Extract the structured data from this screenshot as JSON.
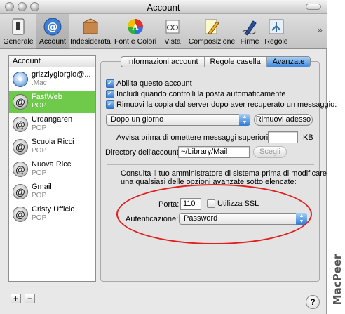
{
  "window": {
    "title": "Account"
  },
  "toolbar": {
    "items": [
      {
        "label": "Generale",
        "icon": "switch-icon"
      },
      {
        "label": "Account",
        "icon": "at-icon"
      },
      {
        "label": "Indesiderata",
        "icon": "junk-icon"
      },
      {
        "label": "Font e Colori",
        "icon": "color-wheel-icon"
      },
      {
        "label": "Vista",
        "icon": "glasses-icon"
      },
      {
        "label": "Composizione",
        "icon": "pencil-icon"
      },
      {
        "label": "Firme",
        "icon": "fountain-pen-icon"
      },
      {
        "label": "Regole",
        "icon": "rules-icon"
      }
    ],
    "more": "»"
  },
  "accounts": {
    "header": "Account",
    "items": [
      {
        "name": "grizzlygiorgio@...",
        "type": ".Mac"
      },
      {
        "name": "FastWeb",
        "type": "POP"
      },
      {
        "name": "Urdangaren",
        "type": "POP"
      },
      {
        "name": "Scuola Ricci",
        "type": "POP"
      },
      {
        "name": "Nuova Ricci",
        "type": "POP"
      },
      {
        "name": "Gmail",
        "type": "POP"
      },
      {
        "name": "Cristy Ufficio",
        "type": "POP"
      }
    ],
    "add_label": "+",
    "remove_label": "−"
  },
  "tabs": [
    "Informazioni account",
    "Regole casella",
    "Avanzate"
  ],
  "advanced": {
    "enable_account": "Abilita questo account",
    "include_check": "Includi quando controlli la posta automaticamente",
    "remove_copy": "Rimuovi la copia dal server dopo aver recuperato un messaggio:",
    "remove_when": "Dopo un giorno",
    "remove_now": "Rimuovi adesso",
    "prompt_label": "Avvisa prima di omettere messaggi superiori a",
    "prompt_value": "",
    "prompt_unit": "KB",
    "directory_label": "Directory dell'account:",
    "directory_value": "~/Library/Mail",
    "choose_button": "Scegli",
    "admin_note_1": "Consulta il tuo amministratore di sistema prima di modificare",
    "admin_note_2": "una qualsiasi delle opzioni avanzate sotto elencate:",
    "port_label": "Porta:",
    "port_value": "110",
    "ssl_label": "Utilizza SSL",
    "auth_label": "Autenticazione:",
    "auth_value": "Password"
  },
  "help_label": "?",
  "watermark": "MacPeer",
  "colors": {
    "selection": "#6fc94a",
    "accent": "#3d8ae0",
    "highlight_oval": "#e02020"
  }
}
